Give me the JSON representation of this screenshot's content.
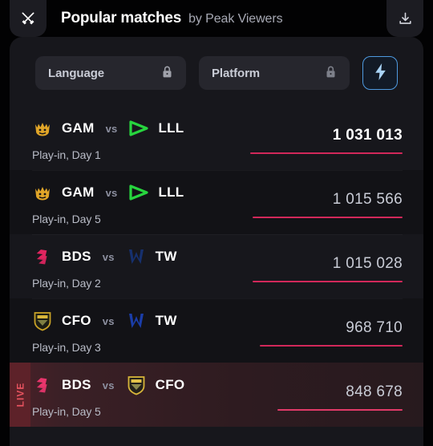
{
  "header": {
    "left_icon": "crossed-swords-icon",
    "title": "Popular matches",
    "subtitle": "by Peak Viewers",
    "right_icon": "download-icon"
  },
  "filters": {
    "language": {
      "label": "Language",
      "locked": true,
      "icon": "lock-icon"
    },
    "platform": {
      "label": "Platform",
      "locked": true,
      "icon": "lock-icon"
    },
    "boost": {
      "icon": "lightning-bolt-icon",
      "active": true
    }
  },
  "colors": {
    "page_background": "#020203",
    "card_background": "#17171c",
    "row_background": "#121216",
    "row_alt_background": "#17171c",
    "bar": "#d2285a",
    "live_text": "#e8535f",
    "live_background": "#5d2229",
    "accent_border": "#4e9ae0",
    "text_primary": "#ffffff",
    "text_secondary": "#b9bcc7"
  },
  "matches": [
    {
      "team_a": {
        "code": "GAM",
        "logo": "gam-crown-logo"
      },
      "vs": "vs",
      "team_b": {
        "code": "LLL",
        "logo": "lll-triangle-logo"
      },
      "stage": "Play-in, Day 1",
      "viewers": "1 031 013",
      "viewers_value": 1031013,
      "bar_percent": 100,
      "live": false,
      "top": true
    },
    {
      "team_a": {
        "code": "GAM",
        "logo": "gam-crown-logo"
      },
      "vs": "vs",
      "team_b": {
        "code": "LLL",
        "logo": "lll-triangle-logo"
      },
      "stage": "Play-in, Day 5",
      "viewers": "1 015 566",
      "viewers_value": 1015566,
      "bar_percent": 98.5,
      "live": false,
      "top": false
    },
    {
      "team_a": {
        "code": "BDS",
        "logo": "bds-s-logo"
      },
      "vs": "vs",
      "team_b": {
        "code": "TW",
        "logo": "tw-w-logo"
      },
      "stage": "Play-in, Day 2",
      "viewers": "1 015 028",
      "viewers_value": 1015028,
      "bar_percent": 98.4,
      "live": false,
      "top": false
    },
    {
      "team_a": {
        "code": "CFO",
        "logo": "cfo-shield-logo"
      },
      "vs": "vs",
      "team_b": {
        "code": "TW",
        "logo": "tw-w-logo"
      },
      "stage": "Play-in, Day 3",
      "viewers": "968 710",
      "viewers_value": 968710,
      "bar_percent": 93.9,
      "live": false,
      "top": false
    },
    {
      "team_a": {
        "code": "BDS",
        "logo": "bds-s-logo"
      },
      "vs": "vs",
      "team_b": {
        "code": "CFO",
        "logo": "cfo-shield-logo"
      },
      "stage": "Play-in, Day 5",
      "viewers": "848 678",
      "viewers_value": 848678,
      "bar_percent": 82.3,
      "live": true,
      "live_label": "LIVE",
      "top": false
    }
  ]
}
